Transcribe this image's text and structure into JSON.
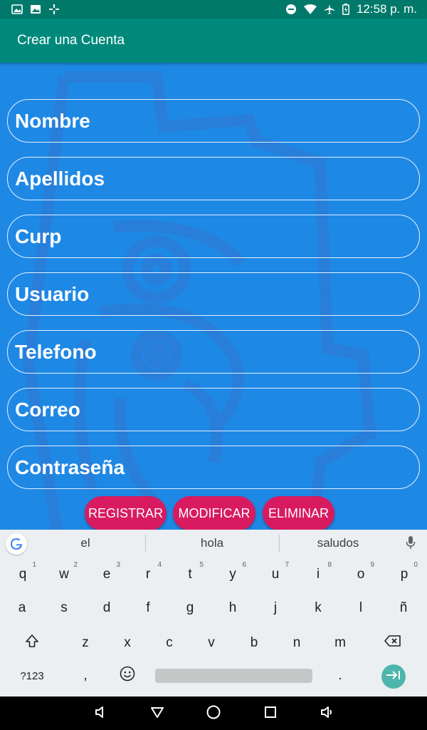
{
  "status_bar": {
    "time": "12:58 p. m."
  },
  "app_bar": {
    "title": "Crear una Cuenta"
  },
  "form": {
    "fields": [
      {
        "placeholder": "Nombre"
      },
      {
        "placeholder": "Apellidos"
      },
      {
        "placeholder": "Curp"
      },
      {
        "placeholder": "Usuario"
      },
      {
        "placeholder": "Telefono"
      },
      {
        "placeholder": "Correo"
      },
      {
        "placeholder": "Contraseña"
      }
    ]
  },
  "buttons": {
    "register": "REGISTRAR",
    "modify": "MODIFICAR",
    "delete": "ELIMINAR"
  },
  "keyboard": {
    "suggestions": [
      "el",
      "hola",
      "saludos"
    ],
    "row1": [
      "q",
      "w",
      "e",
      "r",
      "t",
      "y",
      "u",
      "i",
      "o",
      "p"
    ],
    "row1_hints": [
      "1",
      "2",
      "3",
      "4",
      "5",
      "6",
      "7",
      "8",
      "9",
      "0"
    ],
    "row2": [
      "a",
      "s",
      "d",
      "f",
      "g",
      "h",
      "j",
      "k",
      "l",
      "ñ"
    ],
    "row3": [
      "z",
      "x",
      "c",
      "v",
      "b",
      "n",
      "m"
    ],
    "symbols_key": "?123",
    "comma_key": ",",
    "period_key": "."
  },
  "colors": {
    "status_bar": "#00796b",
    "app_bar": "#00897b",
    "background": "#1e88e5",
    "button": "#d81b60",
    "enter_key": "#4db6ac"
  }
}
